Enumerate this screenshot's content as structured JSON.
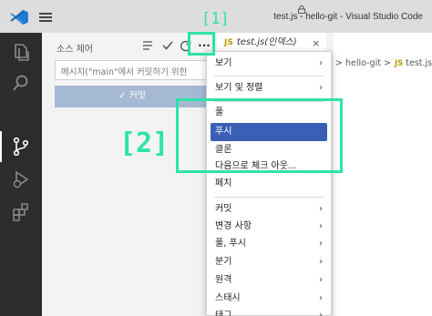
{
  "window": {
    "title": "test.js - hello-git - Visual Studio Code"
  },
  "sidebar": {
    "title": "소스 제어",
    "commit_placeholder": "메시지(\"main\"에서 커밋하기 위한",
    "commit_button": "✓ 커밋",
    "more_actions_label": "···"
  },
  "editor": {
    "tab_lang": "JS",
    "tab_name": "test.js(인덱스)",
    "tab_close": "×",
    "breadcrumb_sep1": ">",
    "breadcrumb_folder": "hello-git",
    "breadcrumb_sep2": ">",
    "breadcrumb_lang": "JS",
    "breadcrumb_file": "test.js"
  },
  "context_menu": {
    "items": [
      {
        "label": "보기",
        "arrow": "›"
      },
      {
        "label": "보기 및 정렬",
        "arrow": "›"
      },
      {
        "label": "풀"
      },
      {
        "label": "푸시",
        "selected": true
      },
      {
        "label": "클론"
      },
      {
        "label": "다음으로 체크 아웃..."
      },
      {
        "label": "페치"
      },
      {
        "label": "커밋",
        "arrow": "›"
      },
      {
        "label": "변경 사항",
        "arrow": "›"
      },
      {
        "label": "풀, 푸시",
        "arrow": "›"
      },
      {
        "label": "분기",
        "arrow": "›"
      },
      {
        "label": "원격",
        "arrow": "›"
      },
      {
        "label": "스태시",
        "arrow": "›"
      },
      {
        "label": "태그",
        "arrow": "›"
      }
    ]
  },
  "annotations": {
    "label1": "[1]",
    "label2": "[2]"
  },
  "colors": {
    "accent_annotation": "#2de3a8",
    "menu_selection": "#3a5fb4",
    "commit_button": "#a6b9d4",
    "activity_bar": "#2c2c2c"
  }
}
